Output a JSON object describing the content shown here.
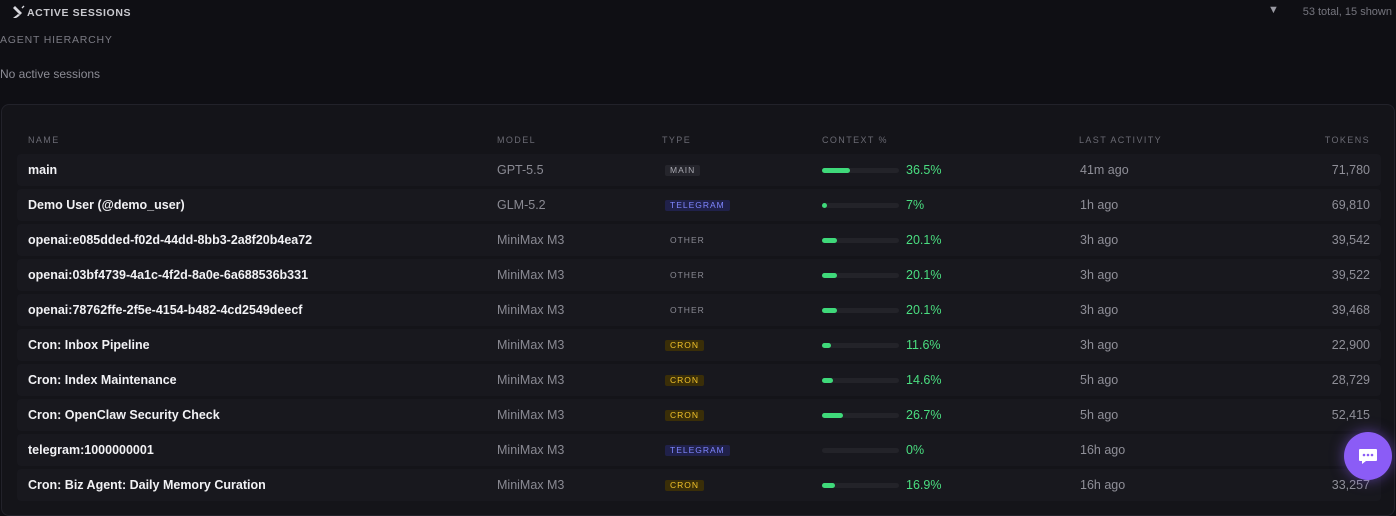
{
  "header": {
    "title": "ACTIVE SESSIONS",
    "collapse_icon": "▼",
    "summary": "53 total, 15 shown"
  },
  "hierarchy": {
    "label": "AGENT HIERARCHY",
    "empty_text": "No active sessions"
  },
  "table": {
    "columns": {
      "name": "NAME",
      "model": "MODEL",
      "type": "TYPE",
      "context": "CONTEXT %",
      "last_activity": "LAST ACTIVITY",
      "tokens": "TOKENS"
    },
    "rows": [
      {
        "name": "main",
        "model": "GPT-5.5",
        "type": "MAIN",
        "context_fraction": 0.365,
        "context": "36.5%",
        "last_activity": "41m ago",
        "tokens": "71,780"
      },
      {
        "name": "Demo User (@demo_user)",
        "model": "GLM-5.2",
        "type": "TELEGRAM",
        "context_fraction": 0.07,
        "context": "7%",
        "last_activity": "1h ago",
        "tokens": "69,810"
      },
      {
        "name": "openai:e085dded-f02d-44dd-8bb3-2a8f20b4ea72",
        "model": "MiniMax M3",
        "type": "OTHER",
        "context_fraction": 0.201,
        "context": "20.1%",
        "last_activity": "3h ago",
        "tokens": "39,542"
      },
      {
        "name": "openai:03bf4739-4a1c-4f2d-8a0e-6a688536b331",
        "model": "MiniMax M3",
        "type": "OTHER",
        "context_fraction": 0.201,
        "context": "20.1%",
        "last_activity": "3h ago",
        "tokens": "39,522"
      },
      {
        "name": "openai:78762ffe-2f5e-4154-b482-4cd2549deecf",
        "model": "MiniMax M3",
        "type": "OTHER",
        "context_fraction": 0.201,
        "context": "20.1%",
        "last_activity": "3h ago",
        "tokens": "39,468"
      },
      {
        "name": "Cron: Inbox Pipeline",
        "model": "MiniMax M3",
        "type": "CRON",
        "context_fraction": 0.116,
        "context": "11.6%",
        "last_activity": "3h ago",
        "tokens": "22,900"
      },
      {
        "name": "Cron: Index Maintenance",
        "model": "MiniMax M3",
        "type": "CRON",
        "context_fraction": 0.146,
        "context": "14.6%",
        "last_activity": "5h ago",
        "tokens": "28,729"
      },
      {
        "name": "Cron: OpenClaw Security Check",
        "model": "MiniMax M3",
        "type": "CRON",
        "context_fraction": 0.267,
        "context": "26.7%",
        "last_activity": "5h ago",
        "tokens": "52,415"
      },
      {
        "name": "telegram:1000000001",
        "model": "MiniMax M3",
        "type": "TELEGRAM",
        "context_fraction": 0.0,
        "context": "0%",
        "last_activity": "16h ago",
        "tokens": ""
      },
      {
        "name": "Cron: Biz Agent: Daily Memory Curation",
        "model": "MiniMax M3",
        "type": "CRON",
        "context_fraction": 0.169,
        "context": "16.9%",
        "last_activity": "16h ago",
        "tokens": "33,257"
      }
    ]
  },
  "chat_button": {
    "icon": "chat-bubble-icon"
  },
  "colors": {
    "background": "#0f0f14",
    "panel": "#141419",
    "bar_fill": "#3fd97a",
    "context_text": "#4ade80",
    "telegram_badge": "#7f86ff",
    "cron_badge": "#f0c129",
    "fab": "#8b5cf6"
  }
}
